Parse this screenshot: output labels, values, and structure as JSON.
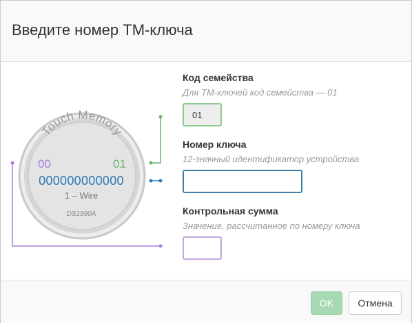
{
  "dialog": {
    "title": "Введите номер ТМ-ключа"
  },
  "key_image": {
    "brand": "Touch Memory",
    "family_code_left": "00",
    "family_code_right": "01",
    "serial": "000000000000",
    "protocol": "1 – Wire",
    "model": "DS1990A",
    "colors": {
      "family": "#6bb36b",
      "serial": "#2e7ab5",
      "crc": "#a77ddb",
      "text_gray": "#888888"
    }
  },
  "fields": {
    "family": {
      "label": "Код семейства",
      "hint": "Для ТМ-ключей код семейства — 01",
      "value": "01"
    },
    "serial": {
      "label": "Номер ключа",
      "hint": "12-значный идентификатор устройства",
      "value": ""
    },
    "crc": {
      "label": "Контрольная сумма",
      "hint": "Значение, рассчитанное по номеру ключа",
      "value": ""
    }
  },
  "footer": {
    "ok_label": "OK",
    "cancel_label": "Отмена"
  }
}
